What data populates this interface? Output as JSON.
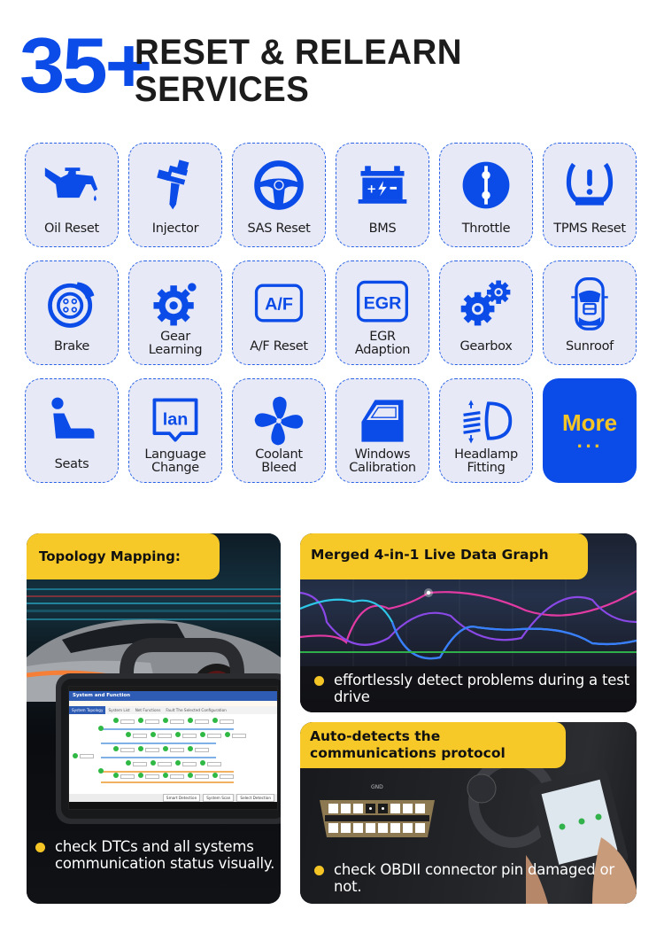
{
  "header": {
    "count": "35+",
    "title_line1": "RESET & RELEARN",
    "title_line2": "SERVICES"
  },
  "colors": {
    "brand_blue": "#0b4ce8",
    "accent_yellow": "#f5c526",
    "tile_bg": "#e7e9f7"
  },
  "services": [
    {
      "label": "Oil Reset",
      "icon": "oil-can-icon"
    },
    {
      "label": "Injector",
      "icon": "injector-icon"
    },
    {
      "label": "SAS Reset",
      "icon": "steering-wheel-icon"
    },
    {
      "label": "BMS",
      "icon": "battery-icon"
    },
    {
      "label": "Throttle",
      "icon": "throttle-icon"
    },
    {
      "label": "TPMS Reset",
      "icon": "tire-pressure-icon"
    },
    {
      "label": "Brake",
      "icon": "brake-disc-icon"
    },
    {
      "label": "Gear\nLearning",
      "icon": "gear-icon"
    },
    {
      "label": "A/F Reset",
      "icon": "af-badge-icon",
      "badge": "A/F"
    },
    {
      "label": "EGR\nAdaption",
      "icon": "egr-badge-icon",
      "badge": "EGR"
    },
    {
      "label": "Gearbox",
      "icon": "gears-icon"
    },
    {
      "label": "Sunroof",
      "icon": "car-top-icon"
    },
    {
      "label": "Seats",
      "icon": "seat-icon"
    },
    {
      "label": "Language\nChange",
      "icon": "language-bubble-icon",
      "badge": "lan"
    },
    {
      "label": "Coolant\nBleed",
      "icon": "fan-icon"
    },
    {
      "label": "Windows\nCalibration",
      "icon": "car-door-icon"
    },
    {
      "label": "Headlamp\nFitting",
      "icon": "headlamp-icon"
    }
  ],
  "more": {
    "label": "More",
    "dots": "..."
  },
  "features": {
    "topology": {
      "title": "Topology Mapping:",
      "bullet": "check DTCs and all systems communication status visually.",
      "screen": {
        "header": "System and Function",
        "tabs": [
          "System Topology",
          "System List",
          "Net Functions",
          "Fault The Selected Configuration"
        ],
        "buttons": [
          "Smart Detection",
          "System Scan",
          "Select Detection"
        ]
      }
    },
    "live_data": {
      "title": "Merged 4-in-1 Live Data Graph",
      "bullet": "effortlessly detect problems during a test drive"
    },
    "protocol": {
      "title_line1": "Auto-detects the",
      "title_line2": "communications protocol",
      "bullet": "check OBDII connector pin damaged or not.",
      "connector_label": "GND"
    }
  }
}
